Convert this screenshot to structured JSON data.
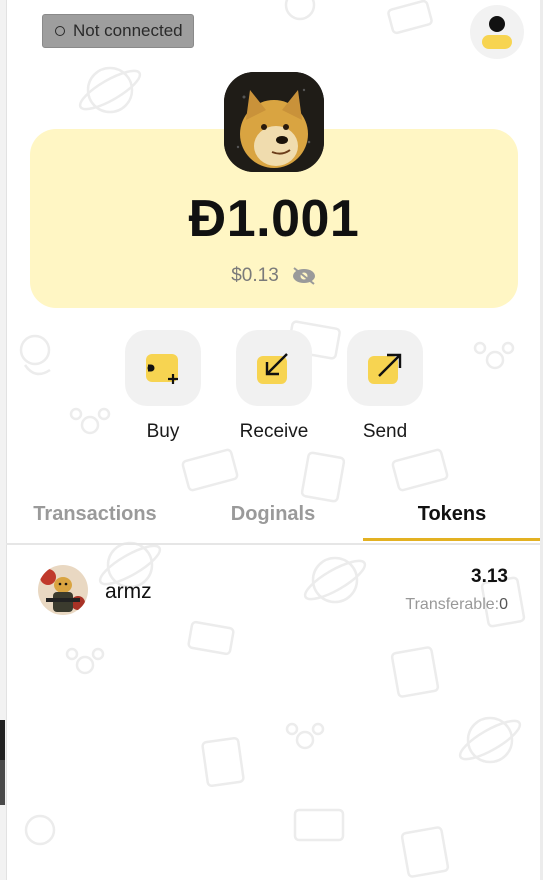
{
  "status": {
    "label": "Not connected"
  },
  "balance": {
    "amount": "Ð1.001",
    "usd": "$0.13"
  },
  "actions": [
    {
      "label": "Buy",
      "icon": "buy-icon"
    },
    {
      "label": "Receive",
      "icon": "receive-arrow-icon"
    },
    {
      "label": "Send",
      "icon": "send-arrow-icon"
    }
  ],
  "tabs": [
    {
      "label": "Transactions",
      "active": false
    },
    {
      "label": "Doginals",
      "active": false
    },
    {
      "label": "Tokens",
      "active": true
    }
  ],
  "tokens": [
    {
      "name": "armz",
      "amount": "3.13",
      "transferable_label": "Transferable:",
      "transferable_value": "0"
    }
  ],
  "colors": {
    "accent": "#e3b122",
    "card": "#fff6c4",
    "icon_yellow": "#f7d451"
  }
}
